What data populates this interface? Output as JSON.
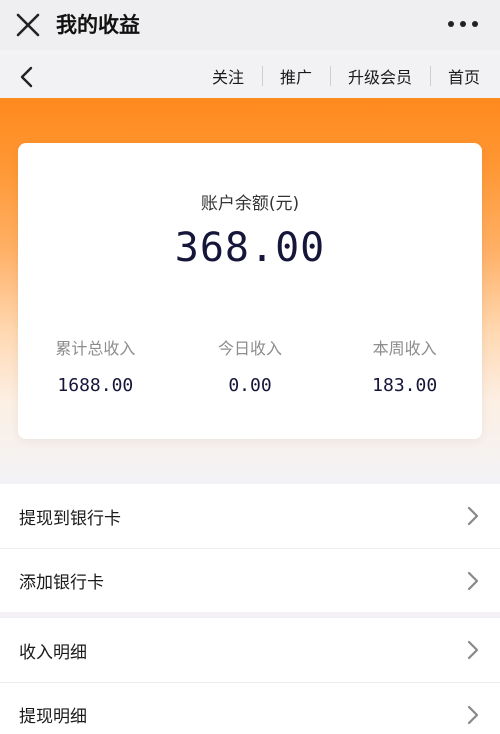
{
  "titlebar": {
    "title": "我的收益",
    "close_icon": "close-icon",
    "more_icon": "more-icon"
  },
  "subnav": {
    "back_icon": "chevron-left-icon",
    "links": [
      {
        "label": "关注"
      },
      {
        "label": "推广"
      },
      {
        "label": "升级会员"
      },
      {
        "label": "首页"
      }
    ]
  },
  "card": {
    "balance_label": "账户余额(元)",
    "balance": "368.00",
    "stats": [
      {
        "label": "累计总收入",
        "value": "1688.00"
      },
      {
        "label": "今日收入",
        "value": "0.00"
      },
      {
        "label": "本周收入",
        "value": "183.00"
      }
    ]
  },
  "menu": {
    "group1": [
      {
        "label": "提现到银行卡"
      },
      {
        "label": "添加银行卡"
      }
    ],
    "group2": [
      {
        "label": "收入明细"
      },
      {
        "label": "提现明细"
      }
    ]
  },
  "colors": {
    "accent": "#ff8a1e",
    "balance_text": "#15163a"
  }
}
